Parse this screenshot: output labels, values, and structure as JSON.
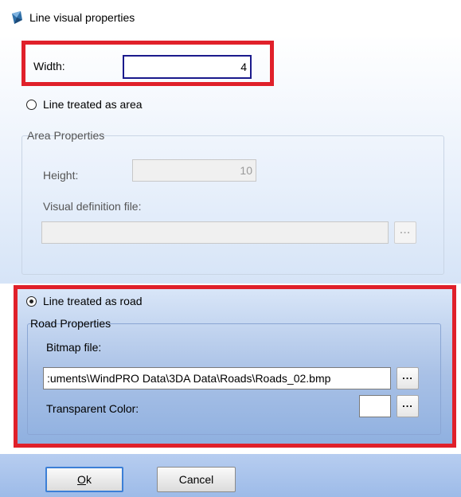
{
  "window": {
    "title": "Line visual properties"
  },
  "width": {
    "label": "Width:",
    "value": "4"
  },
  "area_option": {
    "label": "Line treated as area",
    "selected": false
  },
  "area_properties": {
    "legend": "Area Properties",
    "height_label": "Height:",
    "height_value": "10",
    "visual_def_label": "Visual definition file:",
    "visual_def_value": "",
    "browse_label": "..."
  },
  "road_option": {
    "label": "Line treated as road",
    "selected": true
  },
  "road_properties": {
    "legend": "Road Properties",
    "bitmap_label": "Bitmap file:",
    "bitmap_value": ":uments\\WindPRO Data\\3DA Data\\Roads\\Roads_02.bmp",
    "browse_label": "...",
    "transparent_label": "Transparent Color:",
    "transparent_color": "#ffffff",
    "color_browse_label": "..."
  },
  "buttons": {
    "ok": "Ok",
    "cancel": "Cancel"
  },
  "colors": {
    "highlight_border": "#e0202a",
    "accent": "#3c7fd6"
  }
}
